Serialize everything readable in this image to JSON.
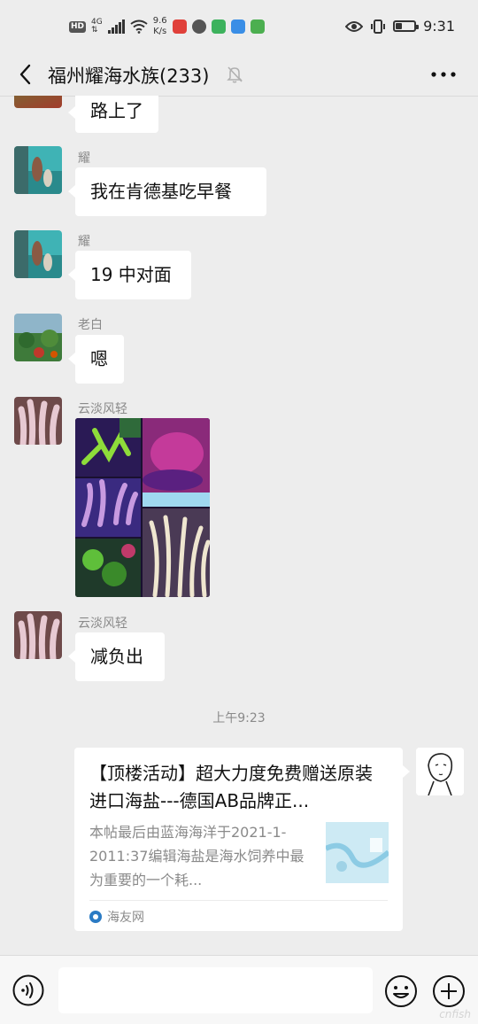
{
  "status_bar": {
    "hd": "HD",
    "network": "4G",
    "speed_value": "9.6",
    "speed_unit": "K/s",
    "time": "9:31"
  },
  "nav": {
    "title": "福州耀海水族(233)"
  },
  "messages": [
    {
      "text": "路上了"
    },
    {
      "sender": "耀",
      "text": "我在肯德基吃早餐"
    },
    {
      "sender": "耀",
      "text": "19 中对面"
    },
    {
      "sender": "老白",
      "text": "嗯"
    },
    {
      "sender": "云淡风轻",
      "type": "image"
    },
    {
      "sender": "云淡风轻",
      "text": "减负出"
    }
  ],
  "time_separator": "上午9:23",
  "link_card": {
    "title": "【顶楼活动】超大力度免费赠送原装进口海盐---德国AB品牌正...",
    "description": "本帖最后由蓝海海洋于2021-1-2011:37编辑海盐是海水饲养中最为重要的一个耗...",
    "source": "海友网"
  },
  "input_bar": {
    "placeholder": ""
  },
  "watermark": "cnfish"
}
